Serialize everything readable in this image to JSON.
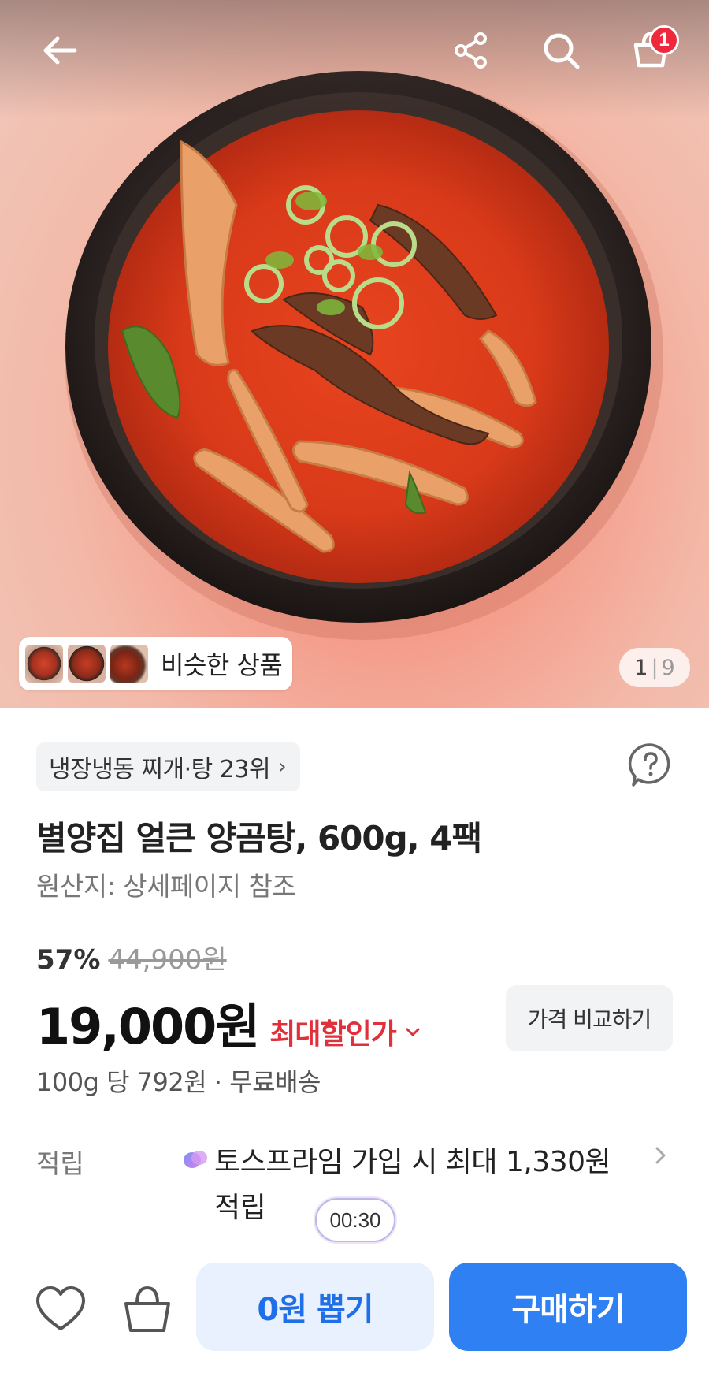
{
  "header": {
    "back_icon": "arrow-left-icon",
    "share_icon": "share-icon",
    "search_icon": "search-icon",
    "cart_icon": "cart-icon",
    "cart_count": "1"
  },
  "gallery": {
    "similar_label": "비슷한 상품",
    "current_page": "1",
    "separator": "|",
    "total_pages": "9"
  },
  "product": {
    "rank_label": "냉장냉동 찌개·탕 23위",
    "rank_chevron": "›",
    "title": "별양집 얼큰 양곰탕, 600g, 4팩",
    "origin": "원산지: 상세페이지 참조"
  },
  "pricing": {
    "discount_rate": "57%",
    "original_price": "44,900원",
    "price": "19,000원",
    "max_discount_label": "최대할인가",
    "compare_button": "가격 비교하기",
    "unit_info": "100g 당 792원 · 무료배송"
  },
  "reward": {
    "label": "적립",
    "text": "토스프라임 가입 시 최대 1,330원 적립",
    "timer": "00:30"
  },
  "bottom_bar": {
    "draw_button": "0원 뽑기",
    "buy_button": "구매하기"
  },
  "colors": {
    "accent_blue": "#2f80f2",
    "discount_red": "#e0303c",
    "badge_red": "#f0283c"
  }
}
